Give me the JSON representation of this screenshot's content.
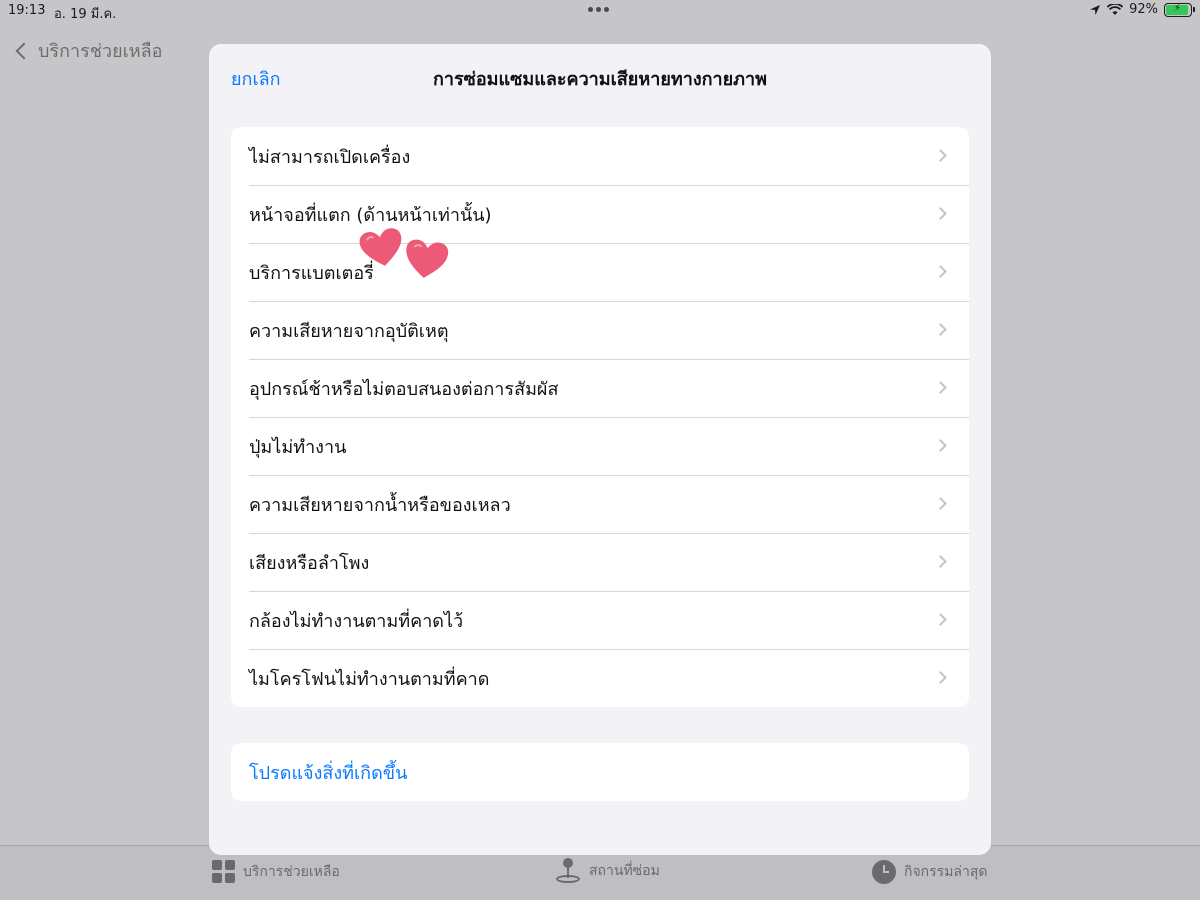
{
  "status_bar": {
    "time": "19:13",
    "date": "อ. 19 มี.ค.",
    "battery_percent": "92%",
    "icons": [
      "location-arrow-icon",
      "wifi-icon",
      "battery-charging-icon"
    ]
  },
  "background": {
    "back_label": "บริการช่วยเหลือ"
  },
  "modal": {
    "cancel_label": "ยกเลิก",
    "title": "การซ่อมแซมและความเสียหายทางกายภาพ",
    "items": [
      {
        "label": "ไม่สามารถเปิดเครื่อง"
      },
      {
        "label": "หน้าจอที่แตก (ด้านหน้าเท่านั้น)"
      },
      {
        "label": "บริการแบตเตอรี่"
      },
      {
        "label": "ความเสียหายจากอุบัติเหตุ"
      },
      {
        "label": "อุปกรณ์ช้าหรือไม่ตอบสนองต่อการสัมผัส"
      },
      {
        "label": "ปุ่มไม่ทำงาน"
      },
      {
        "label": "ความเสียหายจากน้ำหรือของเหลว"
      },
      {
        "label": "เสียงหรือลำโพง"
      },
      {
        "label": "กล้องไม่ทำงานตามที่คาดไว้"
      },
      {
        "label": "ไมโครโฟนไม่ทำงานตามที่คาด"
      }
    ],
    "report_label": "โปรดแจ้งสิ่งที่เกิดขึ้น"
  },
  "tab_bar": {
    "tabs": [
      {
        "label": "บริการช่วยเหลือ",
        "icon": "grid-icon"
      },
      {
        "label": "สถานที่ซ่อม",
        "icon": "map-pin-icon"
      },
      {
        "label": "กิจกรรมล่าสุด",
        "icon": "clock-icon"
      }
    ]
  },
  "colors": {
    "accent": "#0a7aff",
    "heart": "#ec5a78",
    "battery": "#34c759"
  }
}
